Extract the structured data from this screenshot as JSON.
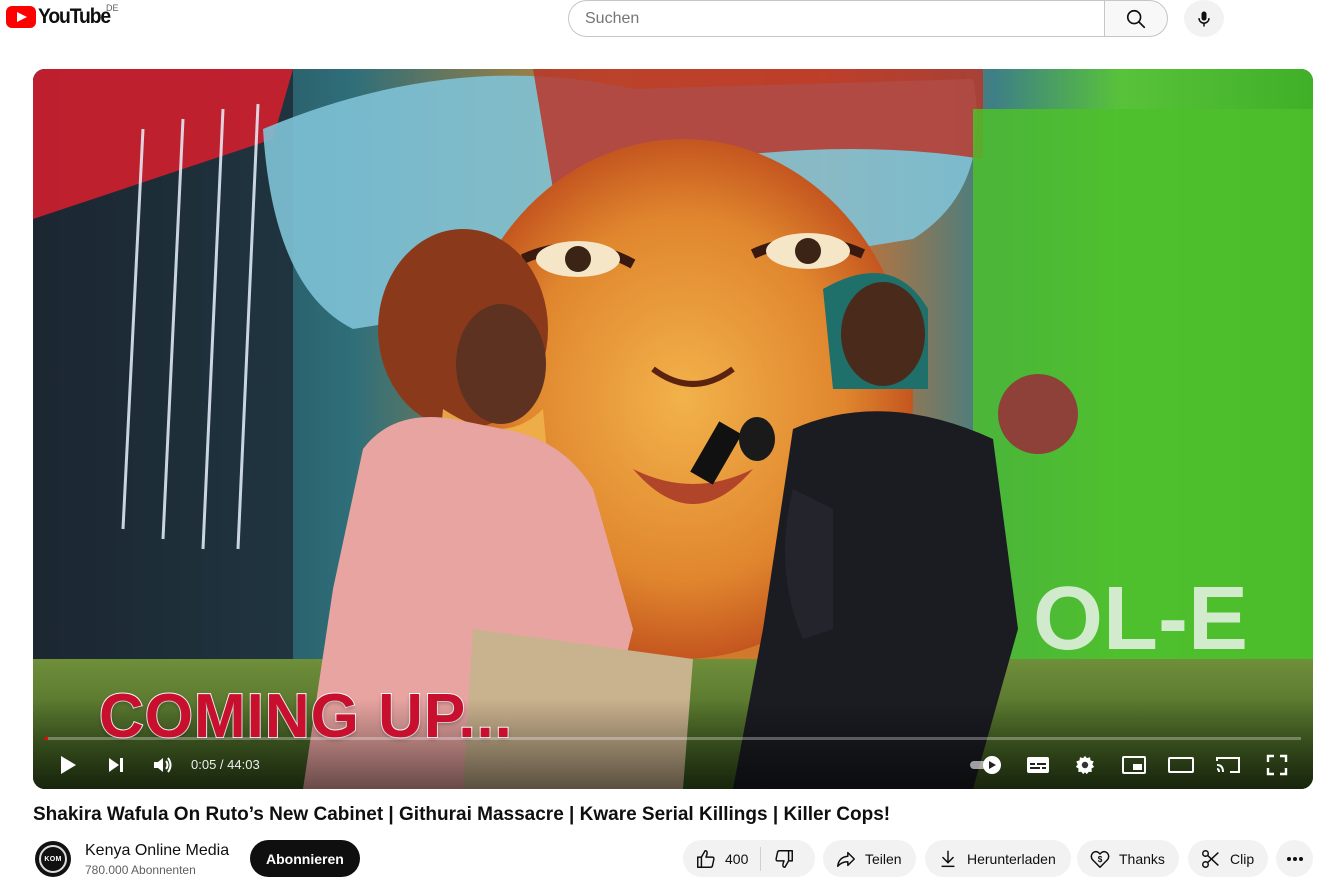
{
  "header": {
    "logo_text": "YouTube",
    "region": "DE",
    "search_placeholder": "Suchen"
  },
  "player": {
    "overlay_text": "COMING UP...",
    "current_time": "0:05",
    "duration": "44:03",
    "time_display": "0:05 / 44:03",
    "progress_fraction": 0.002,
    "autoplay_on": true,
    "brand_colors": {
      "accent": "#ff0000",
      "overlay_red": "#c8102e"
    }
  },
  "video": {
    "title": "Shakira Wafula On Ruto’s New Cabinet | Githurai Massacre | Kware Serial Killings | Killer Cops!"
  },
  "channel": {
    "avatar_text": "KOM",
    "name": "Kenya Online Media",
    "subscribers": "780.000 Abonnenten",
    "subscribe_label": "Abonnieren"
  },
  "actions": {
    "like_count": "400",
    "share_label": "Teilen",
    "download_label": "Herunterladen",
    "thanks_label": "Thanks",
    "clip_label": "Clip"
  },
  "icons": [
    "search-icon",
    "mic-icon",
    "play-icon",
    "next-icon",
    "volume-icon",
    "autoplay-toggle-icon",
    "subtitles-icon",
    "settings-icon",
    "miniplayer-icon",
    "theater-icon",
    "cast-icon",
    "fullscreen-icon",
    "like-icon",
    "dislike-icon",
    "share-icon",
    "download-icon",
    "thanks-icon",
    "clip-icon",
    "more-icon"
  ]
}
